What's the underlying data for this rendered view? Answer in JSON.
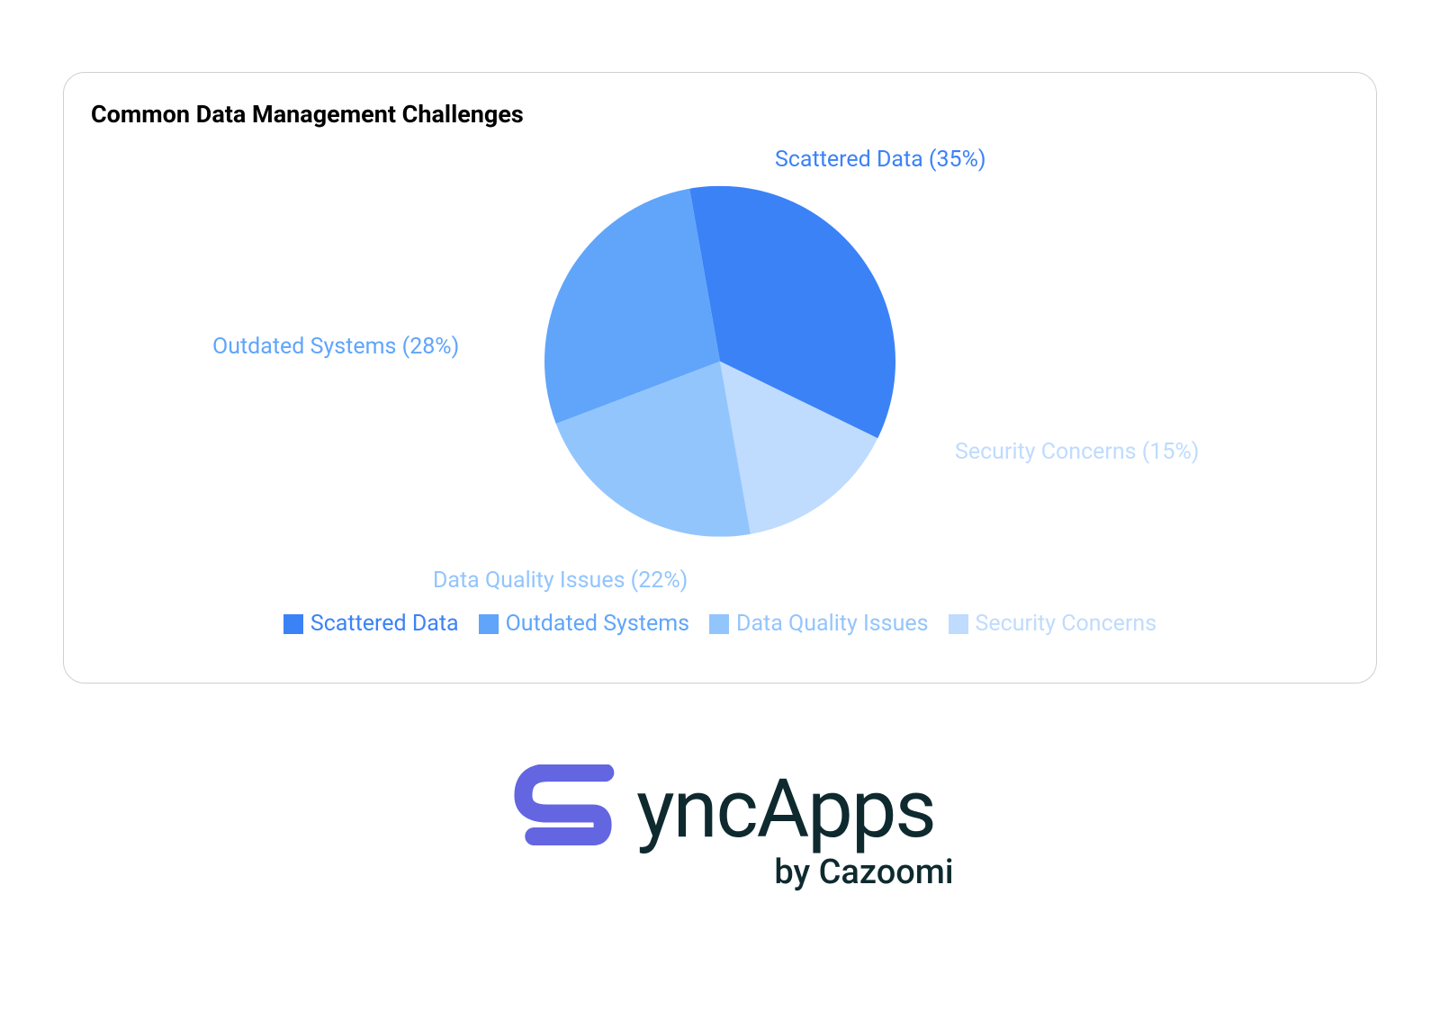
{
  "chart_data": {
    "type": "pie",
    "title": "Common Data Management Challenges",
    "slices": [
      {
        "label": "Scattered Data",
        "value": 35,
        "color": "#3b82f6"
      },
      {
        "label": "Outdated Systems",
        "value": 28,
        "color": "#60a5fa"
      },
      {
        "label": "Data Quality Issues",
        "value": 22,
        "color": "#93c5fd"
      },
      {
        "label": "Security Concerns",
        "value": 15,
        "color": "#bfdbfe"
      }
    ],
    "slice_labels": [
      "Scattered Data (35%)",
      "Outdated Systems (28%)",
      "Data Quality Issues (22%)",
      "Security Concerns (15%)"
    ],
    "legend_labels": [
      "Scattered Data",
      "Outdated Systems",
      "Data Quality Issues",
      "Security Concerns"
    ]
  },
  "brand": {
    "name_rest": "yncApps",
    "byline": "by Cazoomi",
    "logo_color": "#6366e0"
  }
}
